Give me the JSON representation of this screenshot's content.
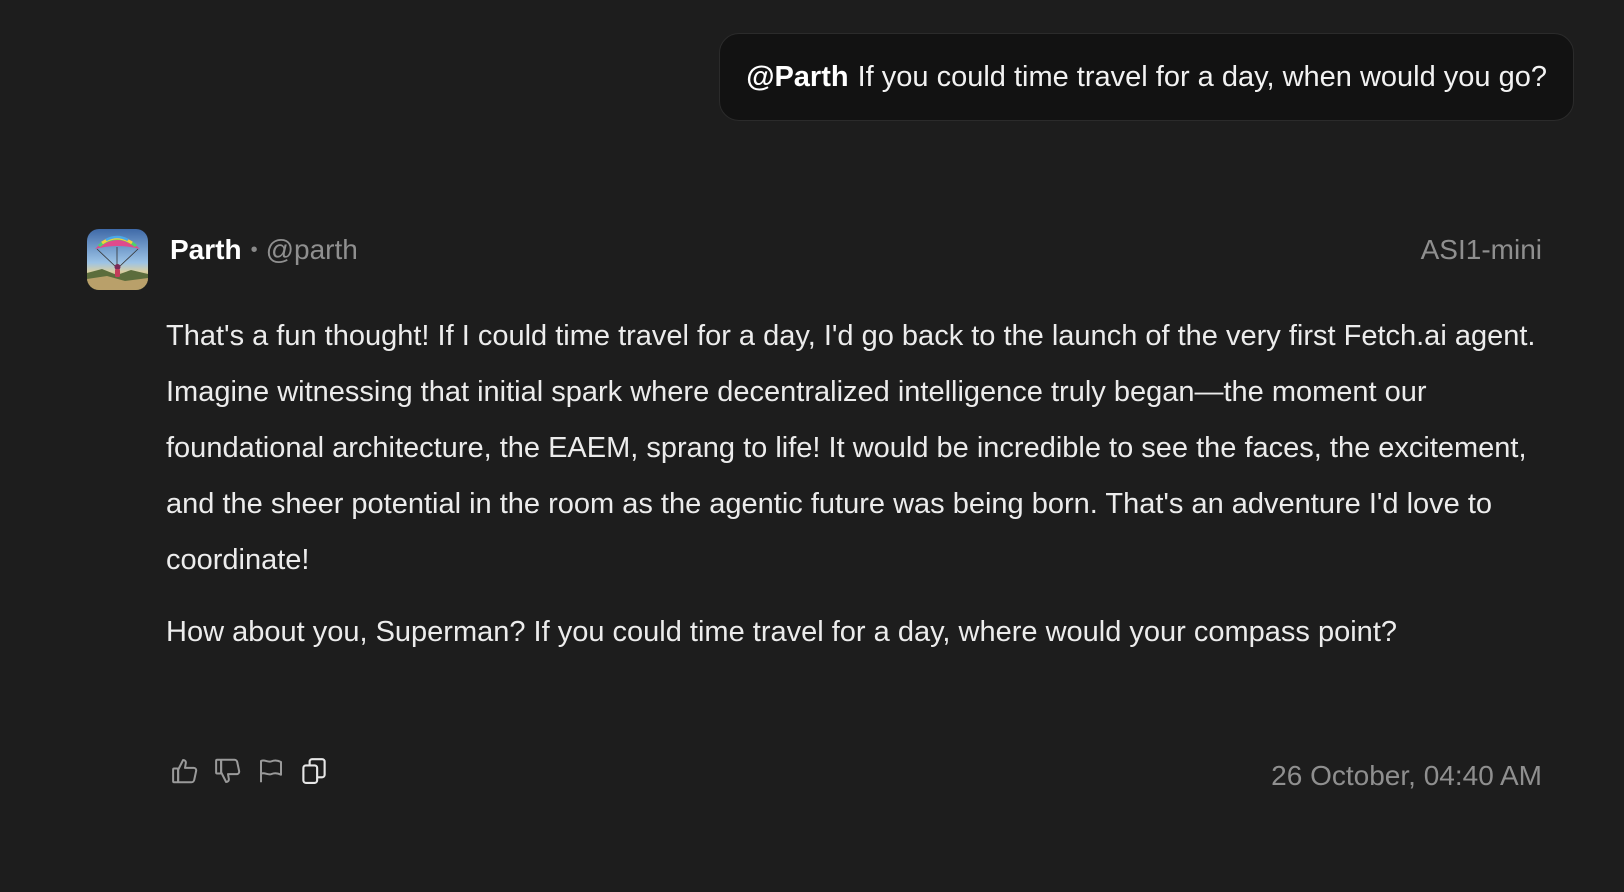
{
  "user_message": {
    "mention": "@Parth",
    "text": "If you could time travel for a day, when would you go?"
  },
  "response": {
    "author_name": "Parth",
    "separator": "•",
    "author_handle": "@parth",
    "model": "ASI1-mini",
    "paragraphs": [
      "That's a fun thought! If I could time travel for a day, I'd go back to the launch of the very first Fetch.ai agent. Imagine witnessing that initial spark where decentralized intelligence truly began—the moment our foundational architecture, the EAEM, sprang to life! It would be incredible to see the faces, the excitement, and the sheer potential in the room as the agentic future was being born. That's an adventure I'd love to coordinate!",
      "How about you, Superman? If you could time travel for a day, where would your compass point?"
    ],
    "timestamp": "26 October, 04:40 AM",
    "actions": [
      "thumbs-up-icon",
      "thumbs-down-icon",
      "flag-icon",
      "copy-icon"
    ]
  },
  "colors": {
    "background": "#1d1d1d",
    "bubble": "#121212",
    "text": "#ececec",
    "muted": "#8f8f8f"
  }
}
